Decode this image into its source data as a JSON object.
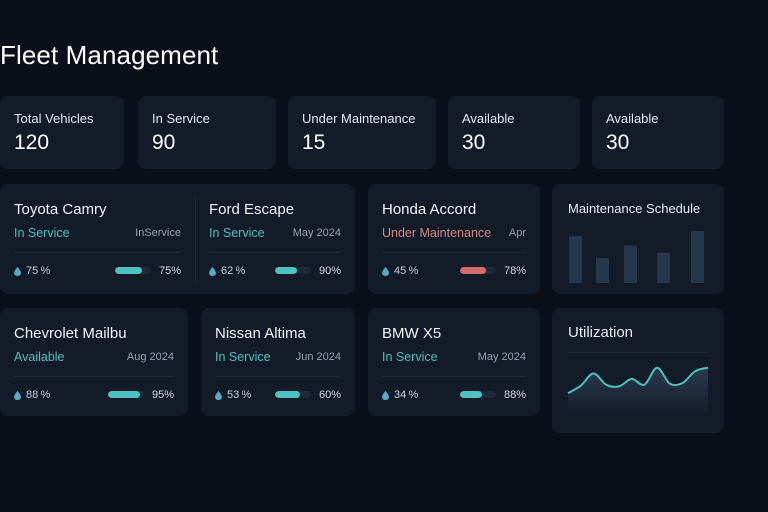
{
  "page": {
    "title": "Fleet Management"
  },
  "stats": [
    {
      "label": "Total Vehicles",
      "value": "120"
    },
    {
      "label": "In Service",
      "value": "90"
    },
    {
      "label": "Under Maintenance",
      "value": "15"
    },
    {
      "label": "Available",
      "value": "30"
    },
    {
      "label": "Available",
      "value": "30"
    }
  ],
  "colors": {
    "in_service": "#4fc1c0",
    "available": "#4fc1c0",
    "maintenance": "#d58a7e",
    "bar_teal": "#4fc1c0",
    "bar_red": "#d46a69",
    "drop": "#5aa7c7"
  },
  "vehicles": [
    {
      "name": "Toyota Camry",
      "status": "In Service",
      "status_kind": "in_service",
      "date": "InService",
      "fuel": "75 %",
      "fuel_level": 0.75,
      "bar_label": "75%",
      "bar_level": 0.75,
      "bar_color": "teal"
    },
    {
      "name": "Ford Escape",
      "status": "In Service",
      "status_kind": "in_service",
      "date": "May 2024",
      "fuel": "62 %",
      "fuel_level": 0.62,
      "bar_label": "90%",
      "bar_level": 0.6,
      "bar_color": "teal"
    },
    {
      "name": "Honda Accord",
      "status": "Under Maintenance",
      "status_kind": "maintenance",
      "date": "Apr",
      "fuel": "45 %",
      "fuel_level": 0.45,
      "bar_label": "78%",
      "bar_level": 0.72,
      "bar_color": "red"
    },
    {
      "name": "Chevrolet Mailbu",
      "status": "Available",
      "status_kind": "available",
      "date": "Aug 2024",
      "fuel": "88 %",
      "fuel_level": 0.88,
      "bar_label": "95%",
      "bar_level": 0.9,
      "bar_color": "teal"
    },
    {
      "name": "Nissan Altima",
      "status": "In Service",
      "status_kind": "in_service",
      "date": "Jun 2024",
      "fuel": "53 %",
      "fuel_level": 0.53,
      "bar_label": "60%",
      "bar_level": 0.7,
      "bar_color": "teal"
    },
    {
      "name": "BMW X5",
      "status": "In Service",
      "status_kind": "in_service",
      "date": "May 2024",
      "fuel": "34 %",
      "fuel_level": 0.34,
      "bar_label": "88%",
      "bar_level": 0.6,
      "bar_color": "teal"
    }
  ],
  "maintenance_panel": {
    "title": "Maintenance Schedule",
    "chart_data": {
      "type": "bar",
      "values": [
        0.9,
        0.48,
        0.72,
        0.58,
        1.0
      ],
      "color": "#27374b"
    }
  },
  "utilization_panel": {
    "title": "Utilization",
    "chart_data": {
      "type": "line",
      "values": [
        0.2,
        0.42,
        0.78,
        0.45,
        0.4,
        0.62,
        0.45,
        0.95,
        0.48,
        0.5,
        0.85,
        0.95
      ],
      "color": "#4fc1c0"
    }
  }
}
